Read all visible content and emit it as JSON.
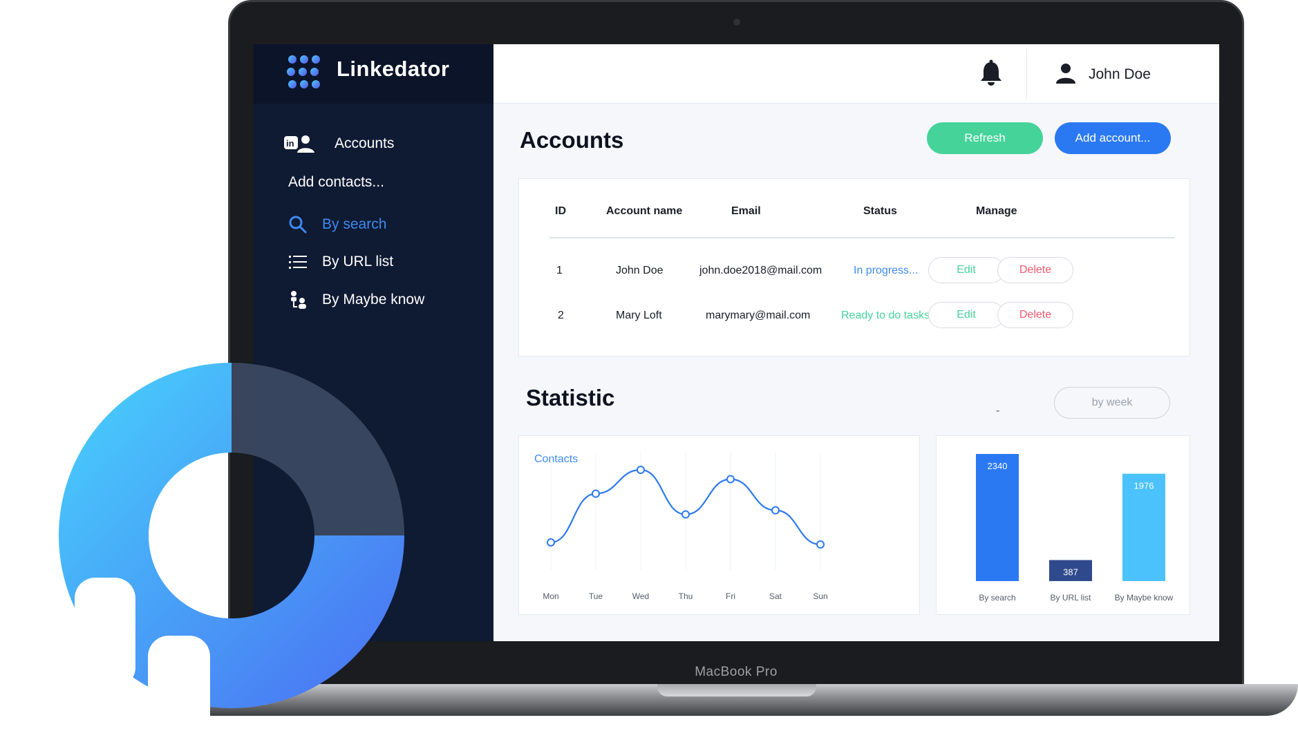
{
  "device": {
    "label": "MacBook Pro"
  },
  "app": {
    "name": "Linkedator"
  },
  "sidebar": {
    "items": [
      {
        "label": "Accounts",
        "icon": "linkedin-users-icon"
      },
      {
        "label": "Add contacts...",
        "icon": ""
      },
      {
        "label": "By search",
        "icon": "search-icon",
        "active": true
      },
      {
        "label": "By URL list",
        "icon": "list-icon"
      },
      {
        "label": "By Maybe know",
        "icon": "people-hierarchy-icon"
      }
    ]
  },
  "topbar": {
    "user_name": "John Doe",
    "bell_icon": "bell-icon",
    "user_icon": "user-icon"
  },
  "accounts": {
    "title": "Accounts",
    "refresh_label": "Refresh",
    "add_label": "Add account...",
    "columns": [
      "ID",
      "Account name",
      "Email",
      "Status",
      "Manage"
    ],
    "rows": [
      {
        "id": "1",
        "name": "John Doe",
        "email": "john.doe2018@mail.com",
        "status": "In progress...",
        "status_color": "#3d8bf2",
        "edit": "Edit",
        "delete": "Delete"
      },
      {
        "id": "2",
        "name": "Mary Loft",
        "email": "marymary@mail.com",
        "status": "Ready to do tasks",
        "status_color": "#46d39a",
        "edit": "Edit",
        "delete": "Delete"
      }
    ]
  },
  "statistic": {
    "title": "Statistic",
    "dash": "-",
    "period_label": "by week"
  },
  "chart_data": [
    {
      "type": "line",
      "title": "Contacts",
      "x": [
        "Mon",
        "Tue",
        "Wed",
        "Thu",
        "Fri",
        "Sat",
        "Sun"
      ],
      "series": [
        {
          "name": "Contacts",
          "values": [
            20,
            67,
            90,
            47,
            81,
            51,
            18
          ]
        }
      ],
      "ylim": [
        0,
        100
      ],
      "grid": "vertical",
      "color": "#2b79f2"
    },
    {
      "type": "bar",
      "categories": [
        "By search",
        "By URL list",
        "By Maybe know"
      ],
      "values": [
        2340,
        387,
        1976
      ],
      "colors": [
        "#2b79f2",
        "#2f4a8c",
        "#4bc2fb"
      ],
      "ylim": [
        0,
        2340
      ]
    }
  ],
  "colors": {
    "accent": "#2b79f2",
    "success": "#46d39a",
    "danger": "#f0566b",
    "sidebar": "#0f1a33"
  }
}
